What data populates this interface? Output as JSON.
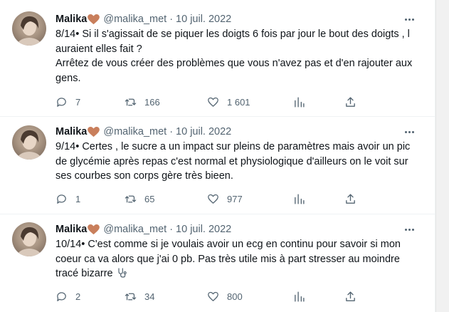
{
  "colors": {
    "text": "#0f1419",
    "muted": "#536471",
    "heart": "#c97f5c",
    "divider": "#eff3f4"
  },
  "tweets": [
    {
      "author": "Malika",
      "handle": "@malika_met",
      "separator": "·",
      "date": "10 juil. 2022",
      "text": "8/14• Si il s'agissait de se piquer les doigts 6 fois par jour le bout des doigts , l auraient elles fait ?\nArrêtez de vous créer des problèmes que vous n'avez pas et d'en rajouter aux gens.",
      "replies": "7",
      "retweets": "166",
      "likes": "1 601"
    },
    {
      "author": "Malika",
      "handle": "@malika_met",
      "separator": "·",
      "date": "10 juil. 2022",
      "text": "9/14• Certes , le sucre a un impact sur pleins de paramètres mais avoir un pic de glycémie après repas c'est normal et physiologique d'ailleurs on le voit sur ses courbes son corps gère très bieen.",
      "replies": "1",
      "retweets": "65",
      "likes": "977"
    },
    {
      "author": "Malika",
      "handle": "@malika_met",
      "separator": "·",
      "date": "10 juil. 2022",
      "text": "10/14• C'est comme si je voulais avoir un ecg en continu pour savoir si mon coeur ca va alors que j'ai 0 pb. Pas très utile mis à part stresser au moindre tracé bizarre",
      "replies": "2",
      "retweets": "34",
      "likes": "800"
    }
  ],
  "icons": {
    "avatar": "avatar-photo",
    "heart_emoji": "brown-heart-icon",
    "more": "more-options-icon",
    "reply": "reply-icon",
    "retweet": "retweet-icon",
    "like": "like-icon",
    "views": "views-icon",
    "share": "share-icon",
    "stethoscope": "stethoscope-icon"
  }
}
